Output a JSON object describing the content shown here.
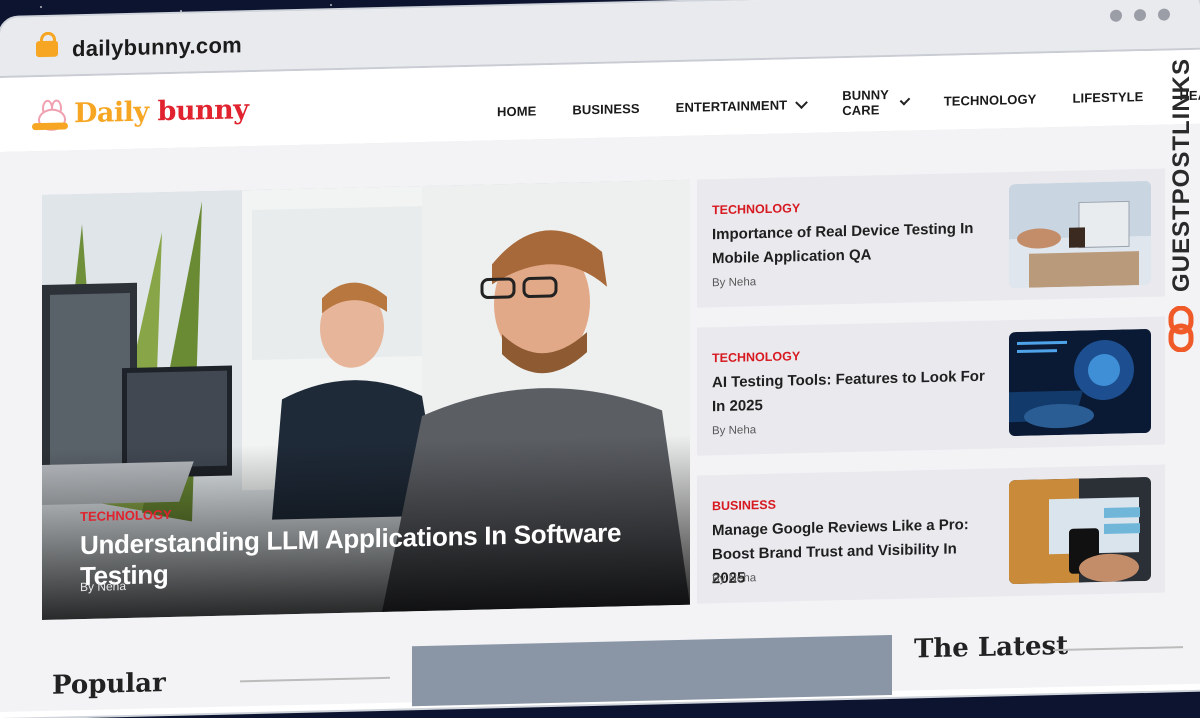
{
  "browser": {
    "url": "dailybunny.com"
  },
  "site": {
    "logo_daily": "Daily",
    "logo_bunny": "bunny"
  },
  "nav": {
    "items": [
      {
        "label": "HOME"
      },
      {
        "label": "BUSINESS"
      },
      {
        "label": "ENTERTAINMENT"
      },
      {
        "label": "BUNNY CARE"
      },
      {
        "label": "TECHNOLOGY"
      },
      {
        "label": "LIFESTYLE"
      },
      {
        "label": "HEALTH"
      }
    ]
  },
  "hero": {
    "category": "TECHNOLOGY",
    "title": "Understanding LLM Applications In Software Testing",
    "author": "By Neha"
  },
  "cards": [
    {
      "category": "TECHNOLOGY",
      "title": "Importance of Real Device Testing In Mobile Application QA",
      "author": "By Neha"
    },
    {
      "category": "TECHNOLOGY",
      "title": "AI Testing Tools: Features to Look For In 2025",
      "author": "By Neha"
    },
    {
      "category": "BUSINESS",
      "title": "Manage Google Reviews Like a Pro: Boost Brand Trust and Visibility In 2025",
      "author": "By Neha"
    }
  ],
  "sections": {
    "latest": "The Latest",
    "left_heading": "Popular"
  },
  "watermark": {
    "text": "GUESTPOSTLINKS"
  },
  "colors": {
    "accent_red": "#e0232e",
    "accent_orange": "#f6a623",
    "background": "#0d1430"
  }
}
